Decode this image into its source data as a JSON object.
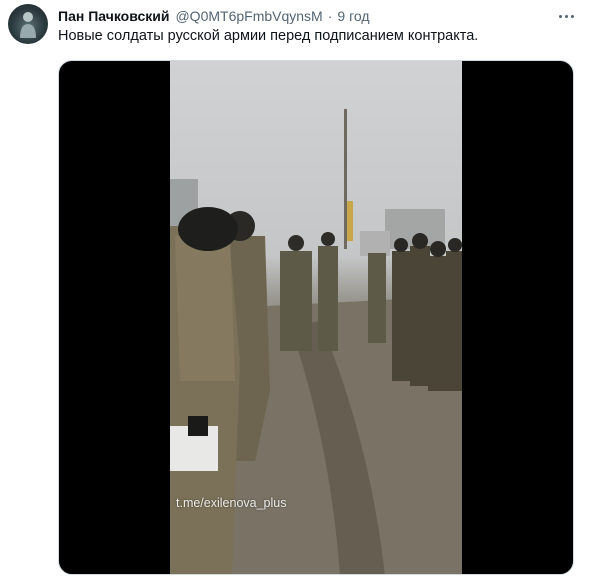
{
  "tweet": {
    "author_name": "Пан Пачковский",
    "author_handle": "@Q0MT6pFmbVqynsM",
    "separator": "·",
    "time": "9 год",
    "text": "Новые солдаты русской армии перед подписанием контракта.",
    "more_icon": "more-horizontal-icon",
    "avatar_icon": "profile-avatar-icon"
  },
  "media": {
    "type": "video",
    "watermark": "t.me/exilenova_plus",
    "background_color": "#000000"
  }
}
